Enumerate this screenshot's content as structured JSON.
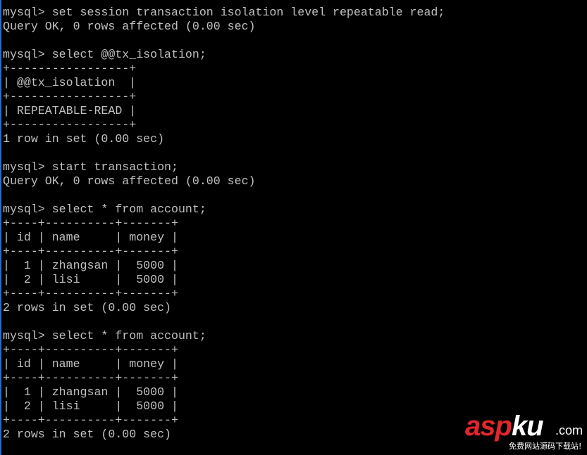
{
  "terminal": {
    "lines": [
      "mysql> set session transaction isolation level repeatable read;",
      "Query OK, 0 rows affected (0.00 sec)",
      "",
      "mysql> select @@tx_isolation;",
      "+-----------------+",
      "| @@tx_isolation  |",
      "+-----------------+",
      "| REPEATABLE-READ |",
      "+-----------------+",
      "1 row in set (0.00 sec)",
      "",
      "mysql> start transaction;",
      "Query OK, 0 rows affected (0.00 sec)",
      "",
      "mysql> select * from account;",
      "+----+----------+-------+",
      "| id | name     | money |",
      "+----+----------+-------+",
      "|  1 | zhangsan |  5000 |",
      "|  2 | lisi     |  5000 |",
      "+----+----------+-------+",
      "2 rows in set (0.00 sec)",
      "",
      "mysql> select * from account;",
      "+----+----------+-------+",
      "| id | name     | money |",
      "+----+----------+-------+",
      "|  1 | zhangsan |  5000 |",
      "|  2 | lisi     |  5000 |",
      "+----+----------+-------+",
      "2 rows in set (0.00 sec)"
    ]
  },
  "watermark": {
    "brand_red": "asp",
    "brand_white": "ku",
    "suffix": ".com",
    "tagline": "免费网站源码下载站!"
  },
  "colors": {
    "text": "#c0c0c0",
    "background": "#000000",
    "brand_red": "#e3262b"
  }
}
